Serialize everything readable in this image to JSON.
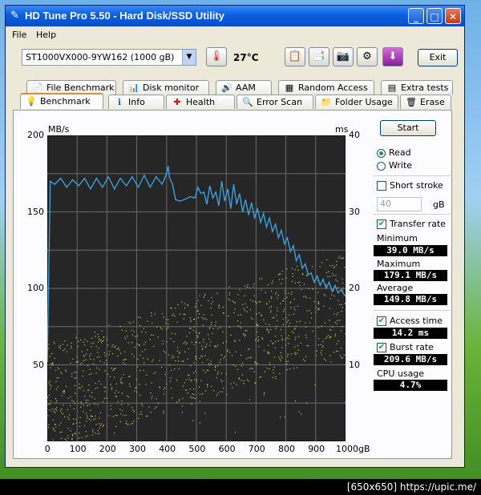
{
  "window": {
    "title": "HD Tune Pro 5.50 - Hard Disk/SSD Utility",
    "minimize": "_",
    "maximize": "□",
    "close": "✕"
  },
  "menu": {
    "file": "File",
    "help": "Help"
  },
  "toolbar": {
    "drive": "ST1000VX000-9YW162 (1000 gB)",
    "temperature": "27°C",
    "exit": "Exit"
  },
  "tabs_top": [
    {
      "label": "File Benchmark",
      "icon": "file-benchmark-icon"
    },
    {
      "label": "Disk monitor",
      "icon": "disk-monitor-icon"
    },
    {
      "label": "AAM",
      "icon": "speaker-icon"
    },
    {
      "label": "Random Access",
      "icon": "random-access-icon"
    },
    {
      "label": "Extra tests",
      "icon": "extra-tests-icon"
    }
  ],
  "tabs_bottom": [
    {
      "label": "Benchmark",
      "icon": "benchmark-icon",
      "active": true
    },
    {
      "label": "Info",
      "icon": "info-icon"
    },
    {
      "label": "Health",
      "icon": "health-icon"
    },
    {
      "label": "Error Scan",
      "icon": "error-scan-icon"
    },
    {
      "label": "Folder Usage",
      "icon": "folder-icon"
    },
    {
      "label": "Erase",
      "icon": "erase-icon"
    }
  ],
  "chart_data": {
    "type": "line",
    "y_left_label": "MB/s",
    "y_right_label": "ms",
    "x_ticks": [
      "0",
      "100",
      "200",
      "300",
      "400",
      "500",
      "600",
      "700",
      "800",
      "900",
      "1000gB"
    ],
    "y_left_ticks": [
      "200",
      "150",
      "100",
      "50"
    ],
    "y_right_ticks": [
      "40",
      "30",
      "20",
      "10"
    ],
    "xlim": [
      0,
      1000
    ],
    "ylim_left": [
      0,
      200
    ],
    "ylim_right": [
      0,
      40
    ],
    "grid": true,
    "colors": {
      "background": "#262626",
      "grid": "#6b6b6b",
      "transfer": "#3aa7e8",
      "access": "#c8c85a"
    },
    "series": [
      {
        "name": "Transfer rate",
        "x": [
          0,
          10,
          25,
          45,
          65,
          85,
          105,
          125,
          145,
          165,
          185,
          205,
          225,
          245,
          265,
          285,
          305,
          325,
          345,
          365,
          385,
          400,
          405,
          410,
          420,
          430,
          445,
          460,
          480,
          495,
          505,
          515,
          525,
          535,
          545,
          555,
          565,
          575,
          585,
          595,
          605,
          615,
          625,
          635,
          645,
          655,
          665,
          675,
          685,
          695,
          705,
          715,
          725,
          735,
          745,
          755,
          765,
          775,
          785,
          795,
          805,
          815,
          825,
          835,
          845,
          855,
          865,
          875,
          885,
          895,
          905,
          915,
          925,
          935,
          945,
          955,
          965,
          975,
          985,
          995,
          1000
        ],
        "y": [
          52,
          170,
          168,
          172,
          166,
          171,
          167,
          172,
          165,
          172,
          166,
          173,
          165,
          172,
          167,
          173,
          166,
          174,
          166,
          173,
          168,
          175,
          180,
          172,
          168,
          158,
          157,
          158,
          160,
          159,
          166,
          162,
          163,
          155,
          167,
          159,
          163,
          154,
          170,
          157,
          165,
          152,
          168,
          155,
          162,
          150,
          158,
          148,
          156,
          146,
          152,
          143,
          149,
          140,
          146,
          137,
          142,
          133,
          138,
          129,
          133,
          124,
          128,
          118,
          122,
          113,
          116,
          109,
          110,
          104,
          108,
          102,
          106,
          100,
          104,
          98,
          102,
          97,
          99,
          96,
          95
        ]
      },
      {
        "name": "Access time",
        "type": "scatter",
        "note": "Dense scatter of access-time samples (ms) rising from ~6 ms at start to ~18 ms at end; average 14.2 ms"
      }
    ]
  },
  "side": {
    "start": "Start",
    "read": "Read",
    "write": "Write",
    "short_stroke": "Short stroke",
    "short_value": "40",
    "gb": "gB",
    "transfer_rate": "Transfer rate",
    "minimum_label": "Minimum",
    "minimum": "39.0 MB/s",
    "maximum_label": "Maximum",
    "maximum": "179.1 MB/s",
    "average_label": "Average",
    "average": "149.8 MB/s",
    "access_time": "Access time",
    "access_value": "14.2 ms",
    "burst_rate": "Burst rate",
    "burst_value": "209.6 MB/s",
    "cpu_label": "CPU usage",
    "cpu_value": "4.7%"
  },
  "footer": "[650x650] https://upic.me/"
}
